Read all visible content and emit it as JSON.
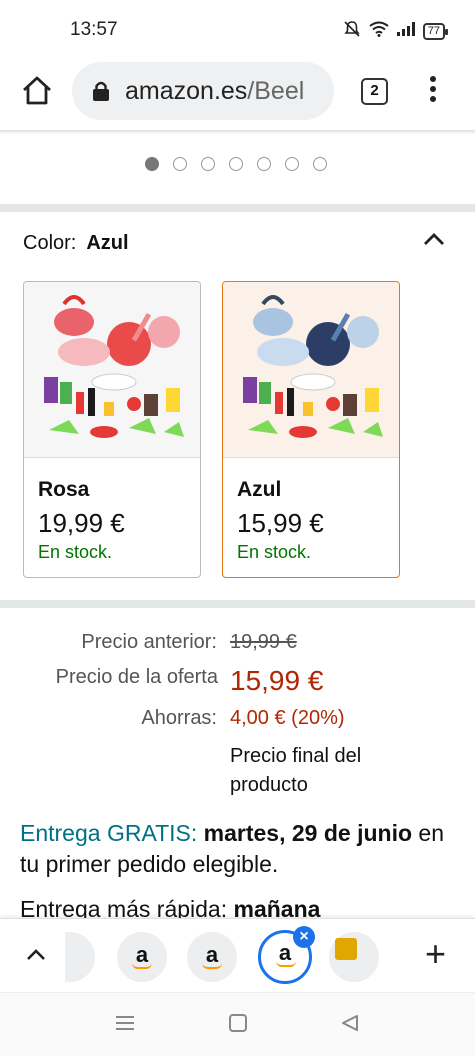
{
  "status": {
    "time": "13:57",
    "battery": "77"
  },
  "browser": {
    "url_host": "amazon.es",
    "url_path": "/Beel",
    "tab_count": "2"
  },
  "carousel": {
    "dot_count": 7,
    "active_index": 0
  },
  "color_selector": {
    "label": "Color:",
    "selected": "Azul",
    "options": [
      {
        "name": "Rosa",
        "price": "19,99 €",
        "stock": "En stock."
      },
      {
        "name": "Azul",
        "price": "15,99 €",
        "stock": "En stock."
      }
    ]
  },
  "pricing": {
    "previous_label": "Precio anterior:",
    "previous_value": "19,99 €",
    "deal_label": "Precio de la oferta",
    "deal_value": "15,99 €",
    "savings_label": "Ahorras:",
    "savings_value": "4,00 € (20%)",
    "final_note": "Precio final del producto"
  },
  "delivery": {
    "free_label": "Entrega GRATIS:",
    "date_bold": "martes, 29 de junio",
    "condition": "en tu primer pedido elegible.",
    "faster_label": "Entrega más rápida:",
    "faster_value": "mañana"
  },
  "tab_strip": {
    "tabs": [
      "a",
      "a",
      "a"
    ]
  },
  "colors": {
    "accent_orange": "#e47911",
    "price_red": "#b12704",
    "stock_green": "#007600",
    "link_teal": "#007185",
    "chrome_blue": "#1a73e8"
  }
}
